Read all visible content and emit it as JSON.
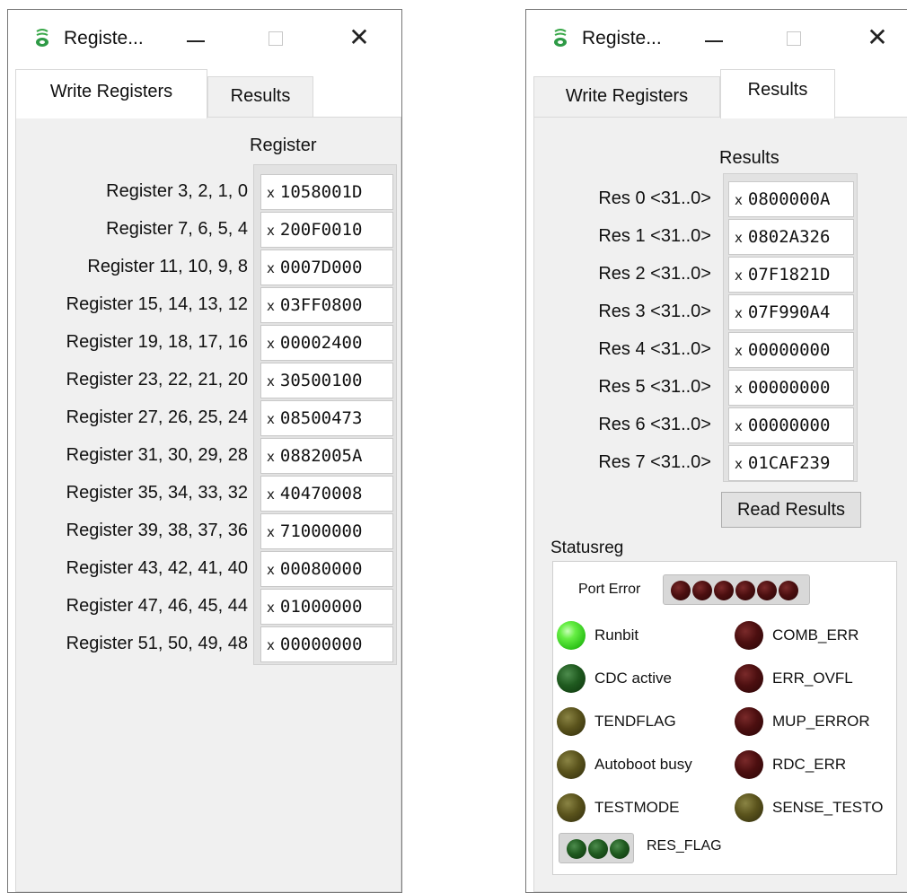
{
  "left_window": {
    "title": "Registe...",
    "tabs": [
      {
        "label": "Write Registers"
      },
      {
        "label": "Results"
      }
    ],
    "column_header": "Register",
    "registers": [
      {
        "label": "Register 3, 2, 1, 0",
        "prefix": "x",
        "value": "1058001D"
      },
      {
        "label": "Register 7, 6, 5, 4",
        "prefix": "x",
        "value": "200F0010"
      },
      {
        "label": "Register 11, 10, 9, 8",
        "prefix": "x",
        "value": "0007D000"
      },
      {
        "label": "Register 15, 14, 13, 12",
        "prefix": "x",
        "value": "03FF0800"
      },
      {
        "label": "Register 19, 18, 17, 16",
        "prefix": "x",
        "value": "00002400"
      },
      {
        "label": "Register 23, 22, 21, 20",
        "prefix": "x",
        "value": "30500100"
      },
      {
        "label": "Register 27, 26, 25, 24",
        "prefix": "x",
        "value": "08500473"
      },
      {
        "label": "Register 31, 30, 29, 28",
        "prefix": "x",
        "value": "0882005A"
      },
      {
        "label": "Register 35, 34, 33, 32",
        "prefix": "x",
        "value": "40470008"
      },
      {
        "label": "Register 39, 38, 37, 36",
        "prefix": "x",
        "value": "71000000"
      },
      {
        "label": "Register 43, 42, 41, 40",
        "prefix": "x",
        "value": "00080000"
      },
      {
        "label": "Register 47, 46, 45, 44",
        "prefix": "x",
        "value": "01000000"
      },
      {
        "label": "Register 51, 50, 49, 48",
        "prefix": "x",
        "value": "00000000"
      }
    ]
  },
  "right_window": {
    "title": "Registe...",
    "tabs": [
      {
        "label": "Write Registers"
      },
      {
        "label": "Results"
      }
    ],
    "column_header": "Results",
    "results": [
      {
        "label": "Res 0 <31..0>",
        "prefix": "x",
        "value": "0800000A"
      },
      {
        "label": "Res 1 <31..0>",
        "prefix": "x",
        "value": "0802A326"
      },
      {
        "label": "Res 2 <31..0>",
        "prefix": "x",
        "value": "07F1821D"
      },
      {
        "label": "Res 3 <31..0>",
        "prefix": "x",
        "value": "07F990A4"
      },
      {
        "label": "Res 4 <31..0>",
        "prefix": "x",
        "value": "00000000"
      },
      {
        "label": "Res 5 <31..0>",
        "prefix": "x",
        "value": "00000000"
      },
      {
        "label": "Res 6 <31..0>",
        "prefix": "x",
        "value": "00000000"
      },
      {
        "label": "Res 7 <31..0>",
        "prefix": "x",
        "value": "01CAF239"
      }
    ],
    "read_button": "Read Results",
    "status_group": {
      "title": "Statusreg",
      "port_error_label": "Port Error",
      "port_error_led_count": 6,
      "leds_left": [
        {
          "label": "Runbit",
          "state": "green-on"
        },
        {
          "label": "CDC active",
          "state": "green-off"
        },
        {
          "label": "TENDFLAG",
          "state": "olive"
        },
        {
          "label": "Autoboot busy",
          "state": "olive"
        },
        {
          "label": "TESTMODE",
          "state": "olive"
        }
      ],
      "leds_right": [
        {
          "label": "COMB_ERR",
          "state": "red-off"
        },
        {
          "label": "ERR_OVFL",
          "state": "red-off"
        },
        {
          "label": "MUP_ERROR",
          "state": "red-off"
        },
        {
          "label": "RDC_ERR",
          "state": "red-off"
        },
        {
          "label": "SENSE_TESTO",
          "state": "olive"
        }
      ],
      "res_flag_label": "RES_FLAG",
      "res_flag_led_count": 3
    }
  },
  "colors": {
    "panel_bg": "#f0f0f0",
    "led_on": "#44dd22",
    "led_green_off": "#1f5a1f",
    "led_olive": "#5a531c",
    "led_red_off": "#4c0f10"
  }
}
